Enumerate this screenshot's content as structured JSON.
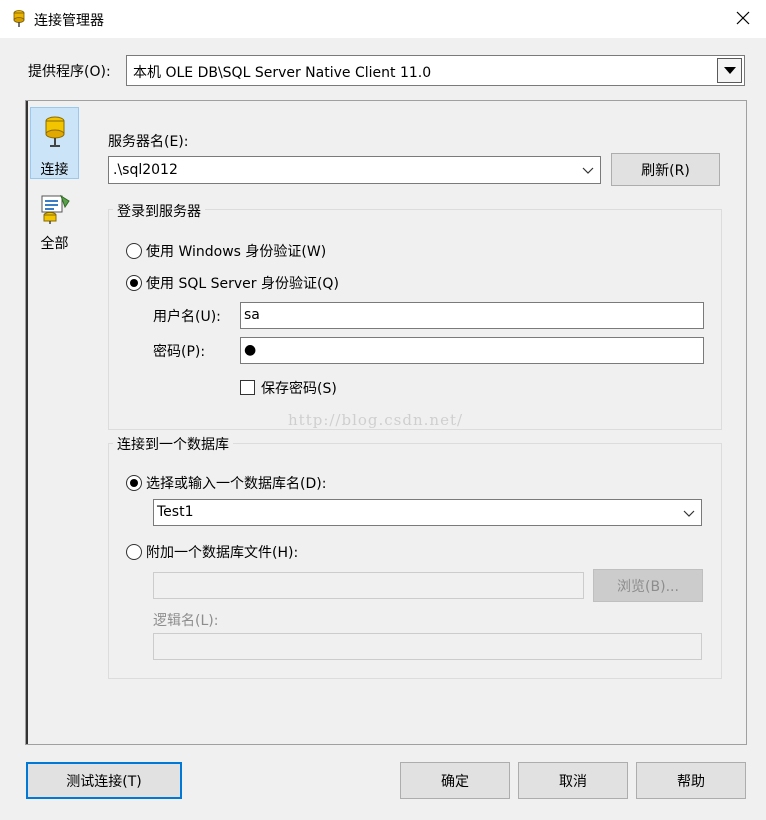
{
  "window": {
    "title": "连接管理器",
    "close_label": "✕"
  },
  "provider": {
    "label": "提供程序(O):",
    "value": "本机 OLE DB\\SQL Server Native Client 11.0"
  },
  "nav": {
    "items": [
      {
        "label": "连接",
        "icon": "database-icon",
        "selected": true
      },
      {
        "label": "全部",
        "icon": "properties-icon",
        "selected": false
      }
    ]
  },
  "server": {
    "label": "服务器名(E):",
    "value": ".\\sql2012",
    "refresh_label": "刷新(R)"
  },
  "login": {
    "group_title": "登录到服务器",
    "windows_auth_label": "使用 Windows 身份验证(W)",
    "sql_auth_label": "使用 SQL Server 身份验证(Q)",
    "selected": "sql",
    "username_label": "用户名(U):",
    "username_value": "sa",
    "password_label": "密码(P):",
    "password_value": "●",
    "save_password_label": "保存密码(S)",
    "save_password_checked": false
  },
  "watermark": "http://blog.csdn.net/",
  "database": {
    "group_title": "连接到一个数据库",
    "select_label": "选择或输入一个数据库名(D):",
    "select_value": "Test1",
    "attach_label": "附加一个数据库文件(H):",
    "attach_value": "",
    "browse_label": "浏览(B)...",
    "logical_name_label": "逻辑名(L):",
    "logical_name_value": "",
    "selected": "select"
  },
  "footer": {
    "test_label": "测试连接(T)",
    "ok_label": "确定",
    "cancel_label": "取消",
    "help_label": "帮助"
  },
  "colors": {
    "accent": "#0078d7",
    "selected_nav_bg": "#cce4f7",
    "dialog_bg": "#f0f0f0"
  }
}
